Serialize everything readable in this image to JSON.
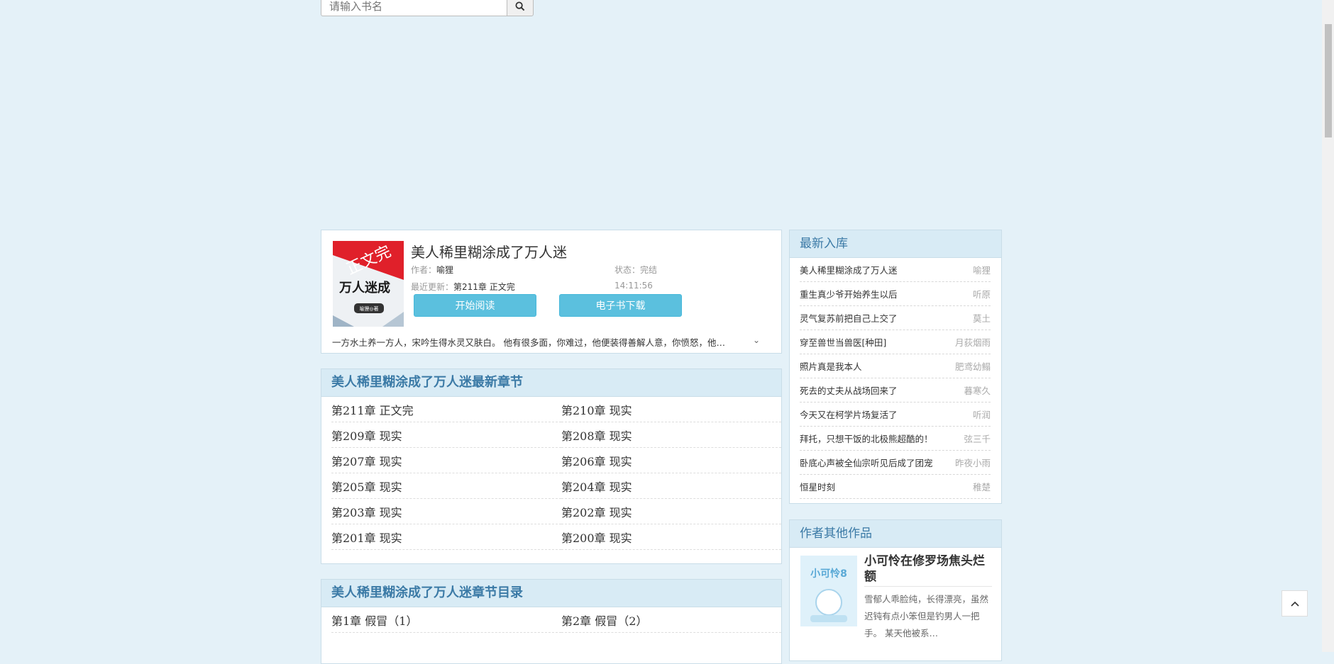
{
  "search": {
    "placeholder": "请输入书名"
  },
  "book": {
    "title": "美人稀里糊涂成了万人迷",
    "author_label": "作者：",
    "author": "喻狸",
    "status_label": "状态：",
    "status": "完结",
    "update_label": "最近更新：",
    "latest_chapter": "第211章 正文完",
    "update_time": "14:11:56",
    "read_button": "开始阅读",
    "download_button": "电子书下载",
    "intro": "一方水土养一方人，宋吟生得水灵又肤白。 他有很多面，你难过，他便装得善解人意，你愤怒，他便装…",
    "cover_text": {
      "banner": "正文完",
      "main": "万人迷成",
      "author": "喻狸◎著"
    }
  },
  "latest": {
    "heading": "美人稀里糊涂成了万人迷最新章节",
    "chapters": [
      "第211章 正文完",
      "第210章 现实",
      "第209章 现实",
      "第208章 现实",
      "第207章 现实",
      "第206章 现实",
      "第205章 现实",
      "第204章 现实",
      "第203章 现实",
      "第202章 现实",
      "第201章 现实",
      "第200章 现实"
    ]
  },
  "catalog": {
    "heading": "美人稀里糊涂成了万人迷章节目录",
    "chapters": [
      "第1章 假冒（1）",
      "第2章 假冒（2）"
    ]
  },
  "new_books": {
    "heading": "最新入库",
    "items": [
      {
        "title": "美人稀里糊涂成了万人迷",
        "author": "喻狸"
      },
      {
        "title": "重生真少爷开始养生以后",
        "author": "听原"
      },
      {
        "title": "灵气复苏前把自己上交了",
        "author": "莫土"
      },
      {
        "title": "穿至兽世当兽医[种田]",
        "author": "月荻烟雨"
      },
      {
        "title": "照片真是我本人",
        "author": "肥鸢幼鳎"
      },
      {
        "title": "死去的丈夫从战场回来了",
        "author": "暮寒久"
      },
      {
        "title": "今天又在柯学片场复活了",
        "author": "听润"
      },
      {
        "title": "拜托，只想干饭的北极熊超酷的！",
        "author": "弦三千"
      },
      {
        "title": "卧底心声被全仙宗听见后成了团宠",
        "author": "昨夜小雨"
      },
      {
        "title": "恒星时刻",
        "author": "稚楚"
      }
    ]
  },
  "other_works": {
    "heading": "作者其他作品",
    "title": "小可怜在修罗场焦头烂额",
    "desc": "雪郁人乖脸纯，长得漂亮，虽然迟钝有点小笨但是钓男人一把手。 某天他被系…",
    "cover_text": "小可怜8"
  }
}
